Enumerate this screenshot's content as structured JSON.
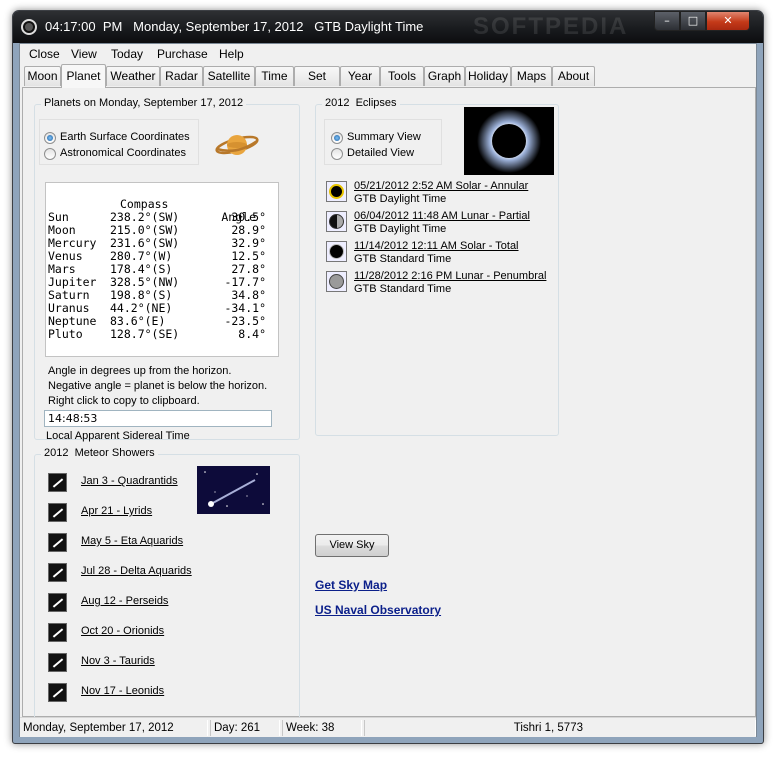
{
  "window": {
    "title": "04:17:00  PM   Monday, September 17, 2012   GTB Daylight Time",
    "watermark": "SOFTPEDIA",
    "minimize_glyph": "–",
    "maximize_glyph": "□",
    "close_glyph": "✕"
  },
  "menu": [
    "Close",
    "View",
    "Today",
    "Purchase",
    "Help"
  ],
  "tabs": [
    "Moon",
    "Planet",
    "Weather",
    "Radar",
    "Satellite",
    "Time",
    "Set",
    "Year",
    "Tools",
    "Graph",
    "Holiday",
    "Maps",
    "About"
  ],
  "active_tab": "Planet",
  "planets_group": {
    "title": "Planets on Monday, September 17, 2012",
    "coordinate_options": [
      {
        "label": "Earth Surface Coordinates",
        "selected": true
      },
      {
        "label": "Astronomical Coordinates",
        "selected": false
      }
    ],
    "table": {
      "headers": {
        "compass": "Compass",
        "angle": "Angle"
      },
      "rows": [
        {
          "name": "Sun",
          "compass": "238.2°(SW)",
          "angle": "30.5°"
        },
        {
          "name": "Moon",
          "compass": "215.0°(SW)",
          "angle": "28.9°"
        },
        {
          "name": "Mercury",
          "compass": "231.6°(SW)",
          "angle": "32.9°"
        },
        {
          "name": "Venus",
          "compass": "280.7°(W)",
          "angle": "12.5°"
        },
        {
          "name": "Mars",
          "compass": "178.4°(S)",
          "angle": "27.8°"
        },
        {
          "name": "Jupiter",
          "compass": "328.5°(NW)",
          "angle": "-17.7°"
        },
        {
          "name": "Saturn",
          "compass": "198.8°(S)",
          "angle": "34.8°"
        },
        {
          "name": "Uranus",
          "compass": "44.2°(NE)",
          "angle": "-34.1°"
        },
        {
          "name": "Neptune",
          "compass": "83.6°(E)",
          "angle": "-23.5°"
        },
        {
          "name": "Pluto",
          "compass": "128.7°(SE)",
          "angle": "8.4°"
        }
      ]
    },
    "notes": [
      "Angle in degrees up from the horizon.",
      "Negative angle = planet is below the horizon.",
      "Right click to copy to clipboard."
    ],
    "sidereal_time": "14:48:53",
    "sidereal_label": "Local Apparent Sidereal Time"
  },
  "meteor_group": {
    "title": "2012  Meteor Showers",
    "showers": [
      "Jan  3 - Quadrantids",
      "Apr 21 - Lyrids",
      "May  5 - Eta Aquarids",
      "Jul 28 - Delta Aquarids",
      "Aug 12 - Perseids",
      "Oct 20 - Orionids",
      "Nov  3 - Taurids",
      "Nov 17 - Leonids"
    ]
  },
  "eclipse_group": {
    "title": "2012  Eclipses",
    "view_options": [
      {
        "label": "Summary View",
        "selected": true
      },
      {
        "label": "Detailed View",
        "selected": false
      }
    ],
    "eclipses": [
      {
        "text": "05/21/2012   2:52 AM  Solar - Annular",
        "zone": "GTB Daylight Time",
        "kind": "solar-annular"
      },
      {
        "text": "06/04/2012   11:48 AM  Lunar - Partial",
        "zone": "GTB Daylight Time",
        "kind": "lunar-partial"
      },
      {
        "text": "11/14/2012   12:11 AM  Solar - Total",
        "zone": "GTB Standard Time",
        "kind": "solar-total"
      },
      {
        "text": "11/28/2012   2:16 PM  Lunar - Penumbral",
        "zone": "GTB Standard Time",
        "kind": "lunar-penumbral"
      }
    ]
  },
  "actions": {
    "view_sky": "View Sky",
    "get_sky_map": "Get Sky Map",
    "naval_observatory": "US Naval Observatory"
  },
  "status": {
    "date": "Monday, September 17, 2012",
    "day": "Day: 261",
    "week": "Week: 38",
    "hebrew_date": "Tishri 1, 5773"
  },
  "colors": {
    "link": "#0b1f8a",
    "close_button": "#c43a19",
    "titlebar": "#191b1e"
  }
}
